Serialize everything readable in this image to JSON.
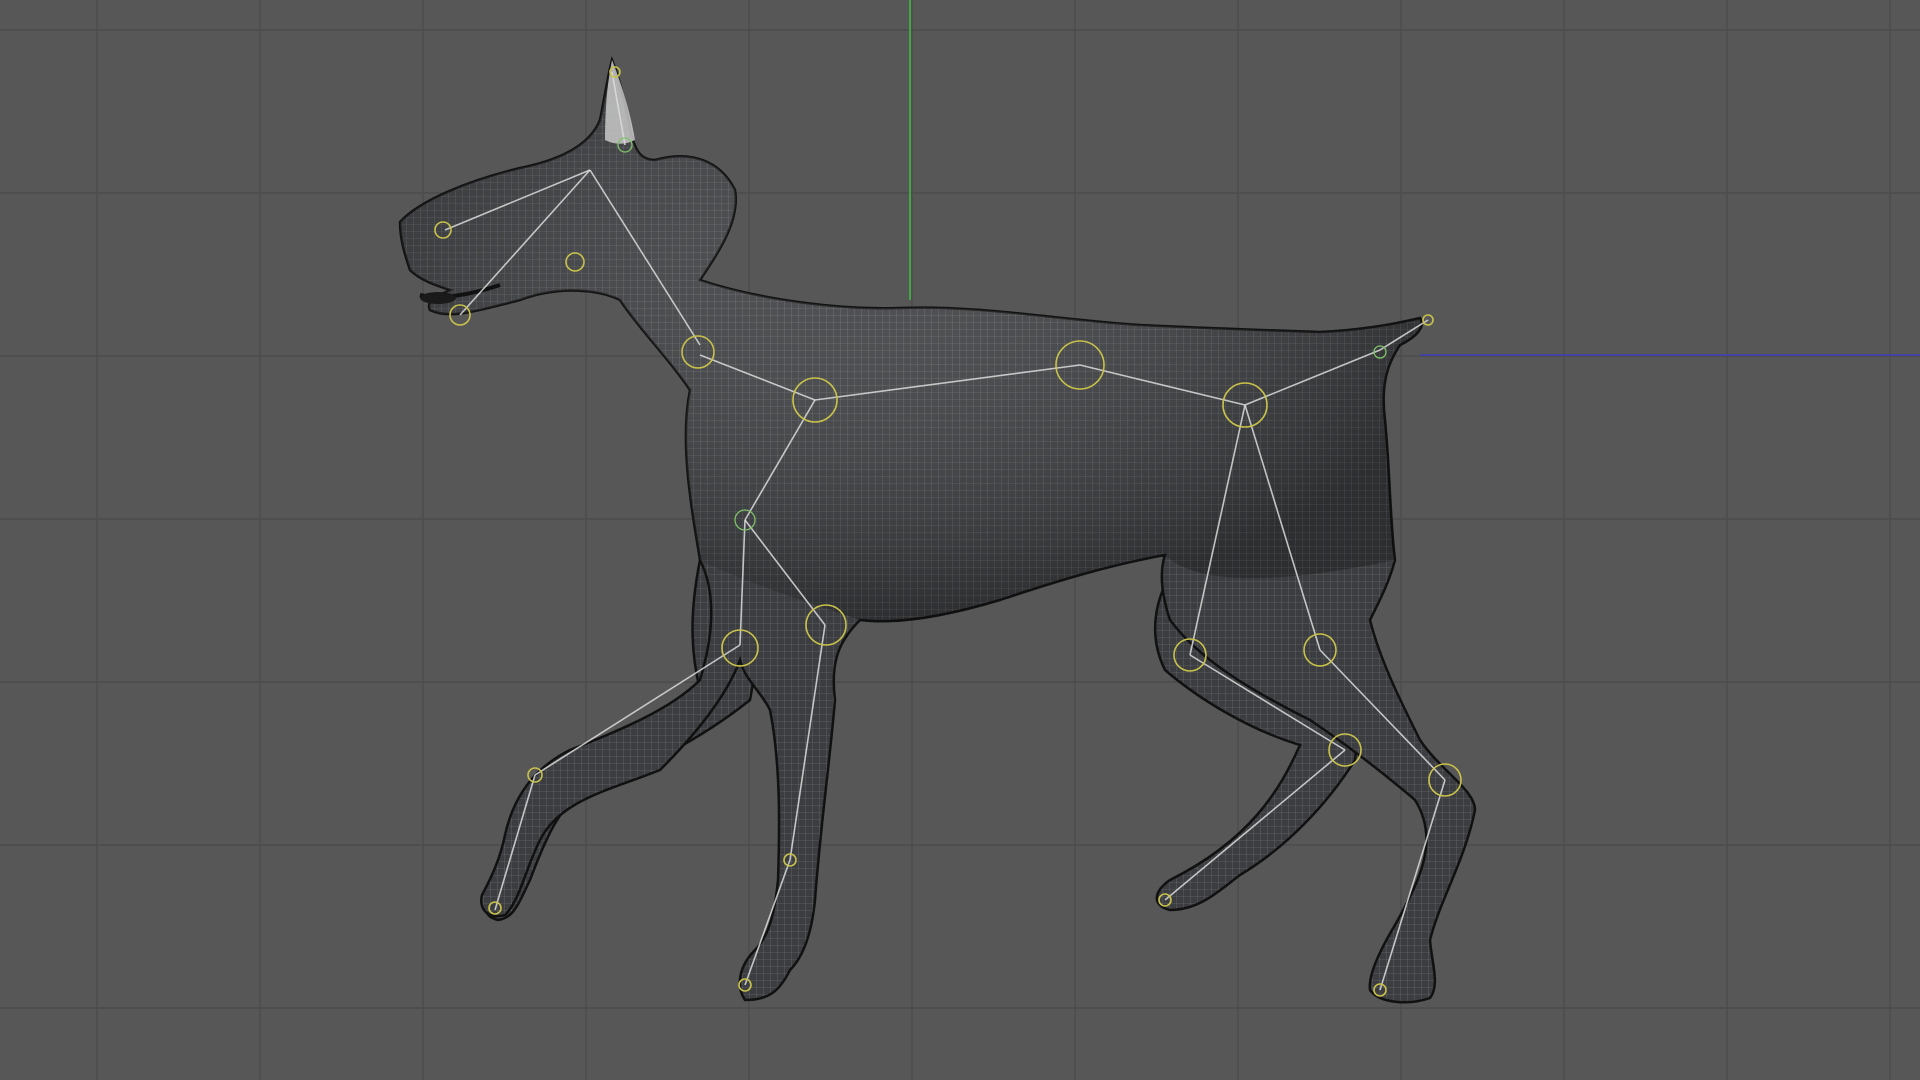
{
  "app": {
    "view": "3d-viewport",
    "background_color": "#575757",
    "grid_color": "#4a4a4a"
  },
  "axes": {
    "y_axis_color": "#3fbf3f",
    "x_axis_color": "#3f3fbf"
  },
  "model": {
    "subject": "dog",
    "display": "wireframe-mesh",
    "rig_visible": true,
    "bone_color": "#dcdcdc",
    "joint_color": "#c9c24a"
  }
}
